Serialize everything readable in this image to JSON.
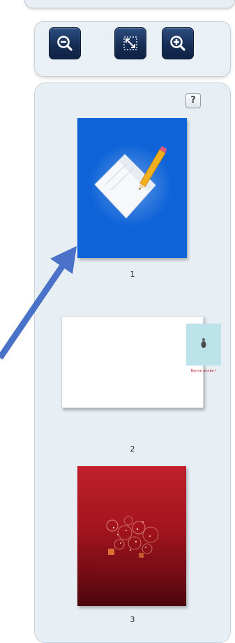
{
  "zoom_toolbar": {
    "buttons": [
      {
        "name": "zoom-out",
        "icon": "zoom-out-icon"
      },
      {
        "name": "fit-page",
        "icon": "fit-page-icon"
      },
      {
        "name": "zoom-in",
        "icon": "zoom-in-icon"
      }
    ]
  },
  "thumbnails_panel": {
    "help_label": "?",
    "pages": [
      {
        "number": "1",
        "thumbnail": "pencil-paper-cover",
        "background": "#0e63d8",
        "selected": true
      },
      {
        "number": "2",
        "thumbnail": "greeting-card-spread",
        "background": "#ffffff",
        "selected": false,
        "card_text": "Bonne année !"
      },
      {
        "number": "3",
        "thumbnail": "red-festive-cover",
        "background": "#b01a24",
        "selected": false
      }
    ]
  },
  "annotation": {
    "type": "arrow",
    "color": "#4a72c8",
    "points_to": "thumbnail-page-1"
  }
}
